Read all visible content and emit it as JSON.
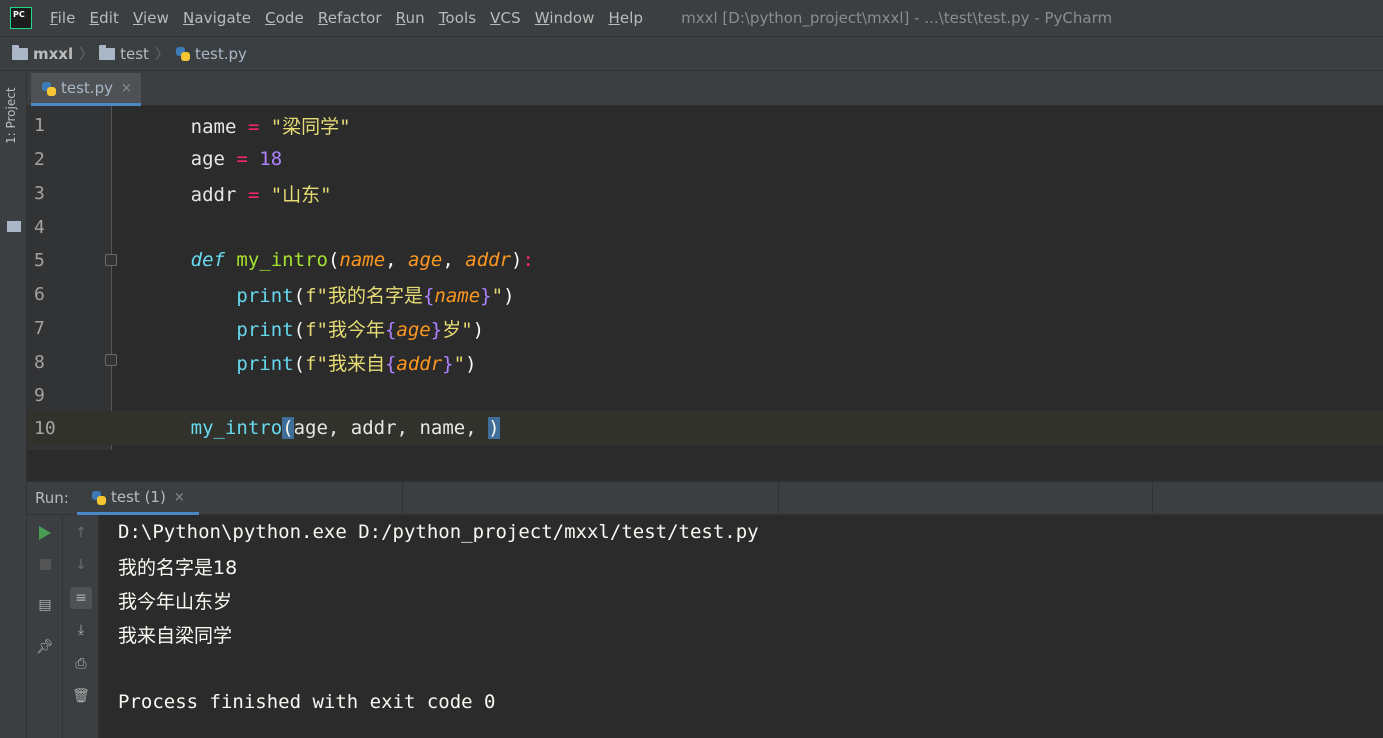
{
  "window": {
    "app_icon": "pycharm-logo",
    "app_icon_text": "PC",
    "title": "mxxl [D:\\python_project\\mxxl] - ...\\test\\test.py - PyCharm"
  },
  "menu": [
    "File",
    "Edit",
    "View",
    "Navigate",
    "Code",
    "Refactor",
    "Run",
    "Tools",
    "VCS",
    "Window",
    "Help"
  ],
  "breadcrumb": {
    "project": "mxxl",
    "folder": "test",
    "file": "test.py"
  },
  "side_panel": {
    "label": "1: Project"
  },
  "editor": {
    "tab": {
      "label": "test.py",
      "close": "×"
    },
    "line_numbers": [
      "1",
      "2",
      "3",
      "4",
      "5",
      "6",
      "7",
      "8",
      "9",
      "10"
    ],
    "current_line": 10,
    "lines": {
      "l1": {
        "var": "name",
        "op": " = ",
        "val": "\"梁同学\""
      },
      "l2": {
        "var": "age",
        "op": " = ",
        "val": "18"
      },
      "l3": {
        "var": "addr",
        "op": " = ",
        "val": "\"山东\""
      },
      "l5": {
        "kw": "def",
        "sp": " ",
        "fn": "my_intro",
        "open": "(",
        "p1": "name",
        "c1": ", ",
        "p2": "age",
        "c2": ", ",
        "p3": "addr",
        "close": ")",
        "colon": ":"
      },
      "l6": {
        "indent": "    ",
        "call": "print",
        "open": "(",
        "pre": "f\"我的名字是",
        "lb": "{",
        "arg": "name",
        "rb": "}",
        "post": "\"",
        "close": ")"
      },
      "l7": {
        "indent": "    ",
        "call": "print",
        "open": "(",
        "pre": "f\"我今年",
        "lb": "{",
        "arg": "age",
        "rb": "}",
        "post": "岁\"",
        "close": ")"
      },
      "l8": {
        "indent": "    ",
        "call": "print",
        "open": "(",
        "pre": "f\"我来自",
        "lb": "{",
        "arg": "addr",
        "rb": "}",
        "post": "\"",
        "close": ")"
      },
      "l10": {
        "fn": "my_intro",
        "open": "(",
        "args": "age, addr, name, ",
        "close": ")"
      }
    }
  },
  "run": {
    "label": "Run:",
    "tab": {
      "label": "test (1)",
      "close": "×"
    },
    "output": [
      "D:\\Python\\python.exe D:/python_project/mxxl/test/test.py",
      "我的名字是18",
      "我今年山东岁",
      "我来自梁同学",
      "",
      "Process finished with exit code 0"
    ]
  },
  "colors": {
    "accent": "#4a88c7",
    "run_green": "#499c54"
  }
}
